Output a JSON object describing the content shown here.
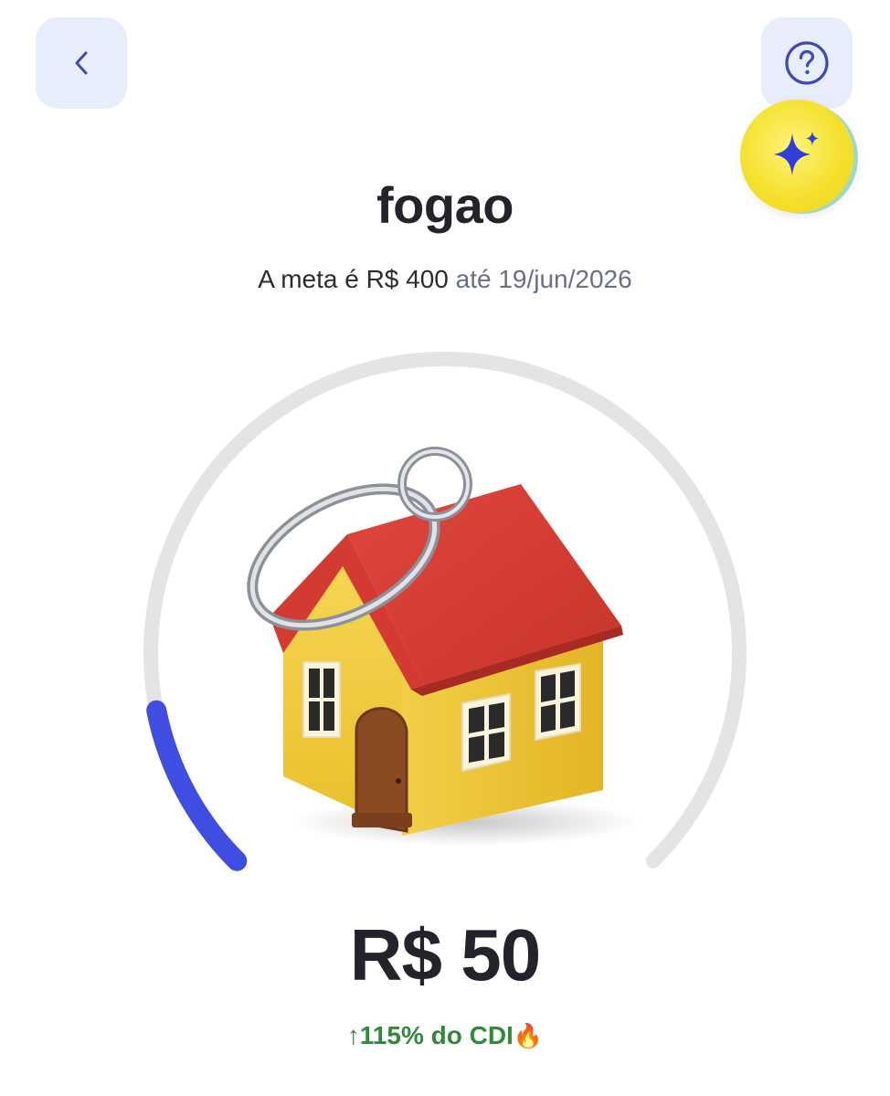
{
  "header": {
    "back_icon": "chevron-left-icon",
    "help_icon": "question-circle-icon",
    "assistant_icon": "sparkle-icon"
  },
  "goal": {
    "name": "fogao",
    "target_prefix": "A meta é R$ 400",
    "deadline": "até 19/jun/2026"
  },
  "progress": {
    "fraction": 0.125,
    "track_color": "#e4e4e4",
    "fill_color": "#3f4de0"
  },
  "illustration": "house-keychain",
  "balance": {
    "amount": "R$ 50",
    "yield_label": "↑115% do CDI",
    "yield_emoji": "🔥",
    "yield_color": "#2f8a3a"
  }
}
